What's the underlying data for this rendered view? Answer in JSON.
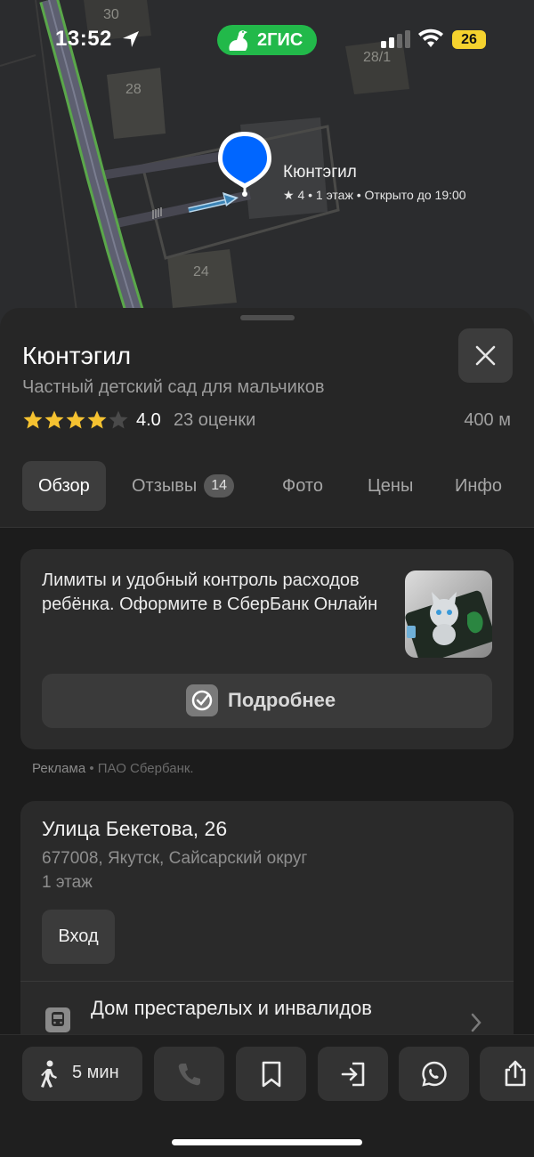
{
  "status_bar": {
    "time": "13:52",
    "brand": "2ГИС",
    "battery": "26"
  },
  "map": {
    "building_numbers": [
      "30",
      "28",
      "28/1",
      "24"
    ],
    "poi": {
      "name": "Кюнтэгил",
      "info": "★ 4 • 1 этаж • Открыто до 19:00"
    }
  },
  "place": {
    "title": "Кюнтэгил",
    "subtitle": "Частный детский сад для мальчиков",
    "rating_value": "4.0",
    "rating_stars": 4,
    "rating_count": "23 оценки",
    "distance": "400 м"
  },
  "tabs": [
    {
      "label": "Обзор",
      "active": true
    },
    {
      "label": "Отзывы",
      "badge": "14"
    },
    {
      "label": "Фото"
    },
    {
      "label": "Цены"
    },
    {
      "label": "Инфо"
    }
  ],
  "ad": {
    "text": "Лимиты и удобный контроль расходов ребёнка. Оформите в СберБанк Онлайн",
    "button_label": "Подробнее",
    "caption_label": "Реклама",
    "caption_advertiser": " • ПАО Сбербанк."
  },
  "address": {
    "street": "Улица Бекетова, 26",
    "city": "677008, Якутск, Сайсарский округ",
    "floor": "1 этаж",
    "entrance_label": "Вход",
    "nearest_stop": "Дом престарелых и инвалидов"
  },
  "bottom_bar": {
    "walk_time": "5 мин"
  },
  "colors": {
    "accent_blue": "#0066ff",
    "brand_green": "#22b94a",
    "star_yellow": "#f5c231",
    "battery_yellow": "#f5d22e"
  }
}
